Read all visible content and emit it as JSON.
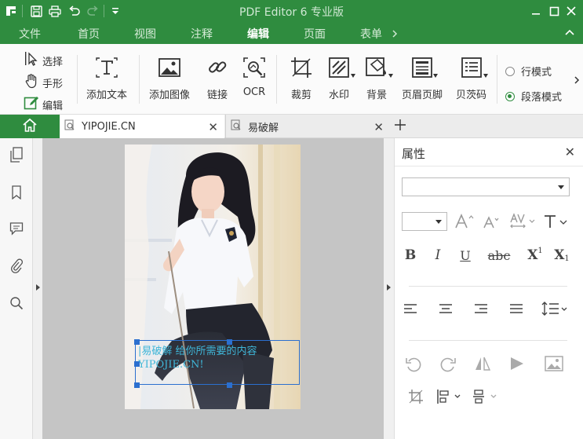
{
  "app": {
    "title": "PDF Editor 6 专业版"
  },
  "menu": {
    "items": [
      "文件",
      "首页",
      "视图",
      "注释",
      "编辑",
      "页面",
      "表单"
    ],
    "active": "编辑"
  },
  "ribbon": {
    "select_label": "选择",
    "hand_label": "手形",
    "edit_label": "编辑",
    "add_text_label": "添加文本",
    "add_image_label": "添加图像",
    "link_label": "链接",
    "ocr_label": "OCR",
    "crop_label": "裁剪",
    "watermark_label": "水印",
    "background_label": "背景",
    "header_footer_label": "页眉页脚",
    "bates_label": "贝茨码",
    "line_mode_label": "行模式",
    "paragraph_mode_label": "段落模式",
    "selected_mode": "段落模式"
  },
  "tabs": [
    {
      "label": "YIPOJIE.CN",
      "active": true
    },
    {
      "label": "易破解",
      "active": false
    }
  ],
  "document": {
    "text_line1": "|易破解 给你所需要的内容",
    "text_line2": "YIPOJIE.CN!"
  },
  "properties_panel": {
    "title": "属性",
    "bold": "B",
    "italic": "I",
    "underline": "U",
    "strike": "abc",
    "superscript_base": "X",
    "superscript_mark": "1",
    "subscript_base": "X",
    "subscript_mark": "1"
  },
  "colors": {
    "brand_green": "#2f8c3f",
    "text_box_blue": "#2b6fcf",
    "doc_text_cyan": "#3fb6d8"
  }
}
